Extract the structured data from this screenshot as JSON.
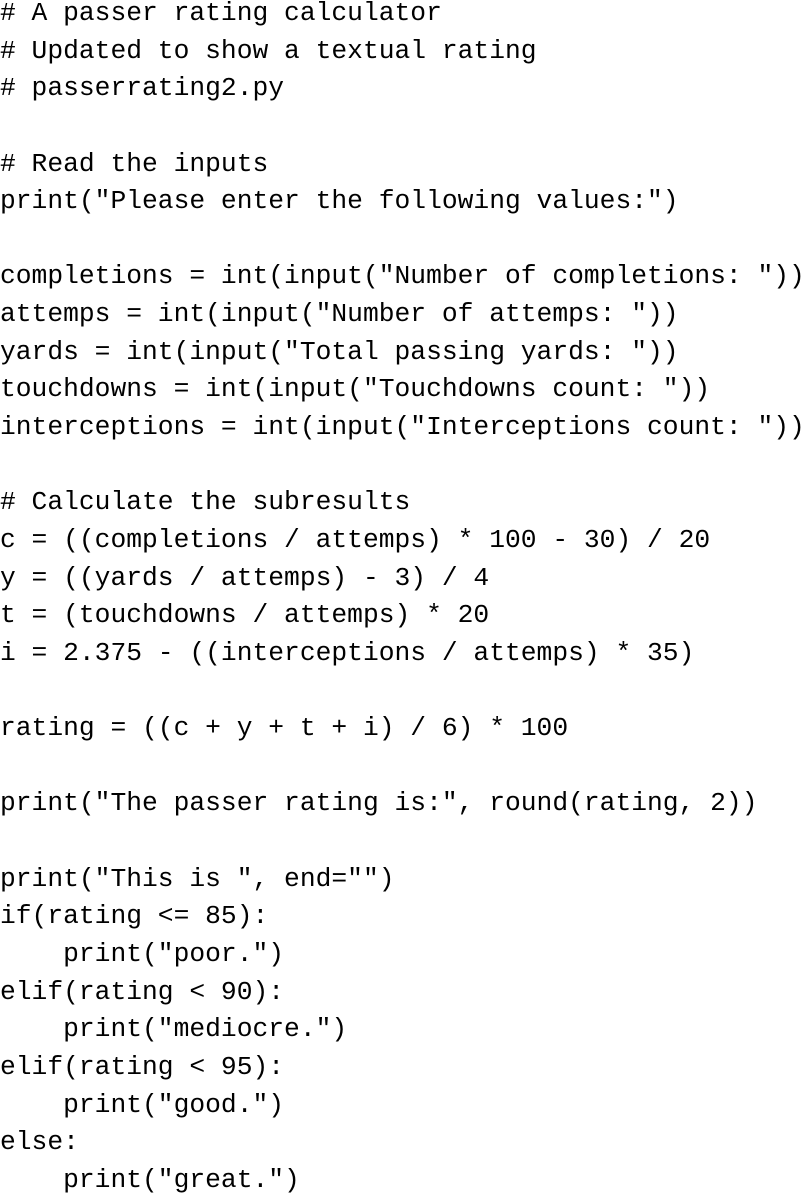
{
  "document": {
    "language": "python",
    "filename_comment": "passerrating2.py",
    "lines": [
      "# A passer rating calculator",
      "# Updated to show a textual rating",
      "# passerrating2.py",
      "",
      "# Read the inputs",
      "print(\"Please enter the following values:\")",
      "",
      "completions = int(input(\"Number of completions: \"))",
      "attemps = int(input(\"Number of attemps: \"))",
      "yards = int(input(\"Total passing yards: \"))",
      "touchdowns = int(input(\"Touchdowns count: \"))",
      "interceptions = int(input(\"Interceptions count: \"))",
      "",
      "# Calculate the subresults",
      "c = ((completions / attemps) * 100 - 30) / 20",
      "y = ((yards / attemps) - 3) / 4",
      "t = (touchdowns / attemps) * 20",
      "i = 2.375 - ((interceptions / attemps) * 35)",
      "",
      "rating = ((c + y + t + i) / 6) * 100",
      "",
      "print(\"The passer rating is:\", round(rating, 2))",
      "",
      "print(\"This is \", end=\"\")",
      "if(rating <= 85):",
      "    print(\"poor.\")",
      "elif(rating < 90):",
      "    print(\"mediocre.\")",
      "elif(rating < 95):",
      "    print(\"good.\")",
      "else:",
      "    print(\"great.\")"
    ]
  }
}
